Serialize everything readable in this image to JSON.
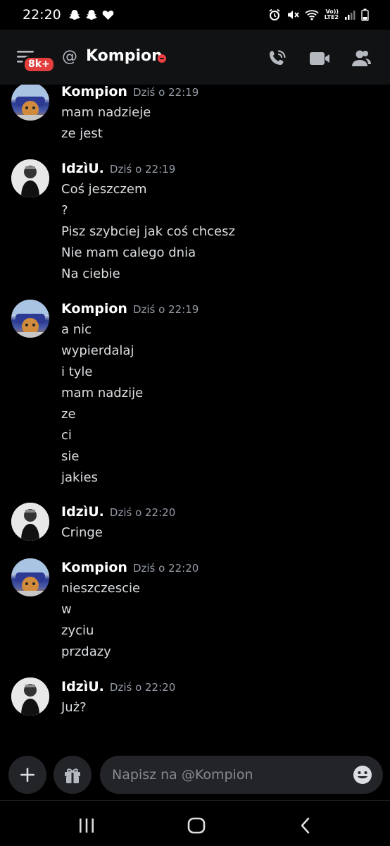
{
  "status_bar": {
    "time": "22:20",
    "lte_top": "Vo))",
    "lte_bottom": "LTE2"
  },
  "header": {
    "badge": "8k+",
    "at_symbol": "@",
    "title": "Kompion"
  },
  "messages": [
    {
      "user": "Kompion",
      "timestamp": "Dziś o 22:19",
      "avatar": "kompion-avatar",
      "lines": [
        "mam nadzieje",
        "ze jest"
      ]
    },
    {
      "user": "IdzìU.",
      "timestamp": "Dziś o 22:19",
      "avatar": "idziu-avatar",
      "lines": [
        "Coś jeszczem",
        "?",
        "Pisz szybciej jak coś chcesz",
        "Nie mam calego dnia",
        "Na ciebie"
      ]
    },
    {
      "user": "Kompion",
      "timestamp": "Dziś o 22:19",
      "avatar": "kompion-avatar",
      "lines": [
        "a nic",
        "wypierdalaj",
        "i tyle",
        "mam nadzije",
        "ze",
        "ci",
        "sie",
        "jakies"
      ]
    },
    {
      "user": "IdzìU.",
      "timestamp": "Dziś o 22:20",
      "avatar": "idziu-avatar",
      "lines": [
        "Cringe"
      ]
    },
    {
      "user": "Kompion",
      "timestamp": "Dziś o 22:20",
      "avatar": "kompion-avatar",
      "lines": [
        "nieszczescie",
        "w",
        "zyciu",
        "przdazy"
      ]
    },
    {
      "user": "IdzìU.",
      "timestamp": "Dziś o 22:20",
      "avatar": "idziu-avatar",
      "lines": [
        "Już?"
      ]
    }
  ],
  "input": {
    "placeholder": "Napisz na @Kompion"
  },
  "colors": {
    "background": "#000000",
    "header": "#111214",
    "badge": "#e23e3e",
    "dnd": "#f23f43",
    "input_bg": "#232428"
  }
}
